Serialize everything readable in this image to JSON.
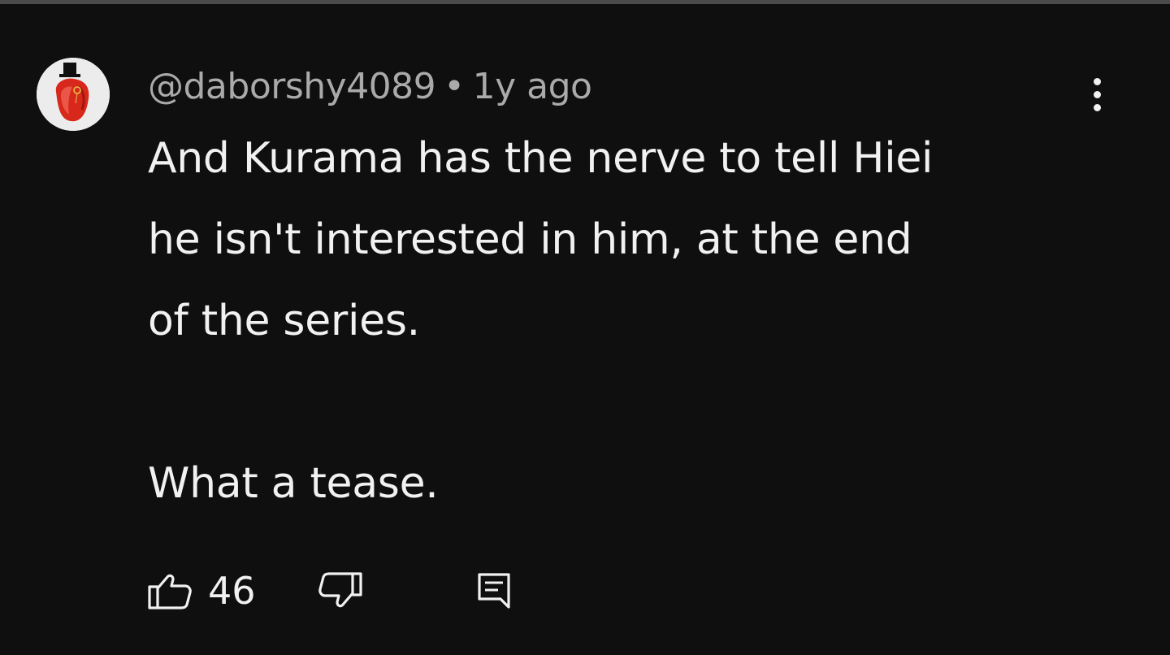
{
  "comment": {
    "author": "@daborshy4089",
    "separator": "•",
    "time_ago": "1y ago",
    "lines": [
      "And Kurama has the nerve to tell Hiei",
      "he isn't interested in him, at the end",
      "of the series."
    ],
    "closing_line": "What a tease.",
    "like_count": "46"
  },
  "icons": {
    "menu": "more-vertical-icon",
    "like": "thumb-up-icon",
    "dislike": "thumb-down-icon",
    "reply": "reply-comment-icon"
  },
  "colors": {
    "background": "#0f0f0f",
    "text": "#f1f1f1",
    "meta_text": "#aaaaaa",
    "avatar_bg": "#ececec",
    "avatar_accent": "#d8281b"
  }
}
